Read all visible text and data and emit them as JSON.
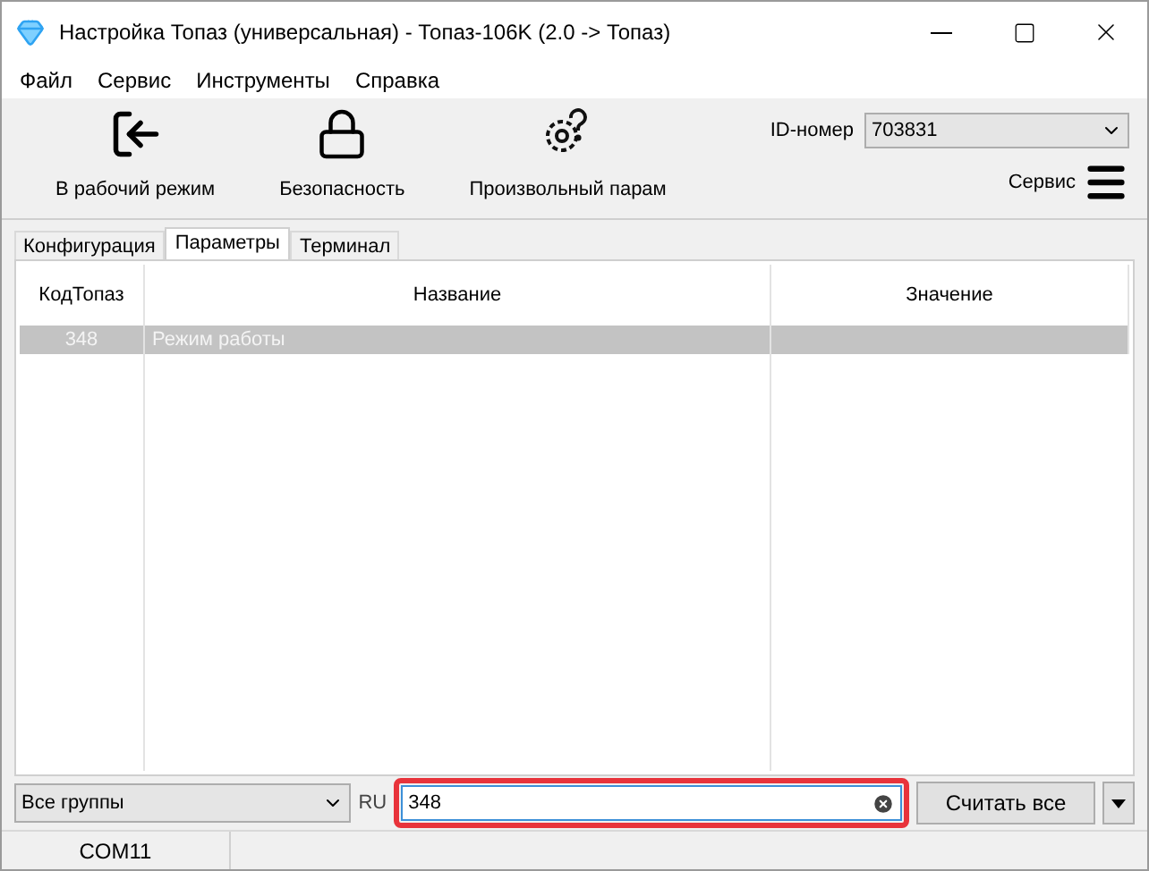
{
  "window": {
    "title": "Настройка Топаз (универсальная) - Топаз-106K (2.0 -> Топаз)"
  },
  "menu": [
    "Файл",
    "Сервис",
    "Инструменты",
    "Справка"
  ],
  "toolbar": [
    {
      "kind": "exit",
      "label": "В рабочий режим"
    },
    {
      "kind": "lock",
      "label": "Безопасность"
    },
    {
      "kind": "gear",
      "label": "Произвольный парам"
    }
  ],
  "id_field": {
    "label": "ID-номер",
    "value": "703831"
  },
  "service": {
    "label": "Сервис"
  },
  "tabs": [
    {
      "label": "Конфигурация",
      "selected": false
    },
    {
      "label": "Параметры",
      "selected": true
    },
    {
      "label": "Терминал",
      "selected": false
    }
  ],
  "table": {
    "columns": [
      "КодТопаз",
      "Название",
      "Значение"
    ],
    "rows": [
      {
        "cells": [
          "348",
          "Режим работы",
          ""
        ],
        "selected": true
      }
    ]
  },
  "group_select": {
    "value": "Все группы"
  },
  "lang": "RU",
  "search": {
    "value": "348",
    "highlighted": true
  },
  "read_button": "Считать все",
  "status_bar": {
    "port": "COM11"
  }
}
